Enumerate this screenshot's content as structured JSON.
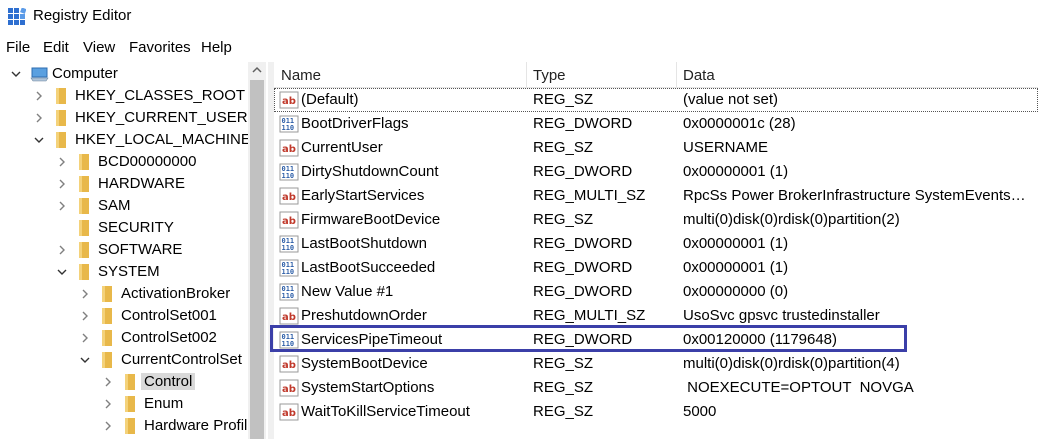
{
  "window": {
    "title": "Registry Editor",
    "icon": "registry-editor-icon"
  },
  "menu": [
    "File",
    "Edit",
    "View",
    "Favorites",
    "Help"
  ],
  "tree": [
    {
      "label": "Computer",
      "level": 0,
      "expanded": true,
      "icon": "computer-icon"
    },
    {
      "label": "HKEY_CLASSES_ROOT",
      "level": 1,
      "expanded": false
    },
    {
      "label": "HKEY_CURRENT_USER",
      "level": 1,
      "expanded": false
    },
    {
      "label": "HKEY_LOCAL_MACHINE",
      "level": 1,
      "expanded": true
    },
    {
      "label": "BCD00000000",
      "level": 2,
      "expanded": false
    },
    {
      "label": "HARDWARE",
      "level": 2,
      "expanded": false
    },
    {
      "label": "SAM",
      "level": 2,
      "expanded": false
    },
    {
      "label": "SECURITY",
      "level": 2,
      "expanded": null
    },
    {
      "label": "SOFTWARE",
      "level": 2,
      "expanded": false
    },
    {
      "label": "SYSTEM",
      "level": 2,
      "expanded": true
    },
    {
      "label": "ActivationBroker",
      "level": 3,
      "expanded": false
    },
    {
      "label": "ControlSet001",
      "level": 3,
      "expanded": false
    },
    {
      "label": "ControlSet002",
      "level": 3,
      "expanded": false
    },
    {
      "label": "CurrentControlSet",
      "level": 3,
      "expanded": true
    },
    {
      "label": "Control",
      "level": 4,
      "expanded": false,
      "selected": true
    },
    {
      "label": "Enum",
      "level": 4,
      "expanded": false
    },
    {
      "label": "Hardware Profil",
      "level": 4,
      "expanded": false
    }
  ],
  "columns": {
    "name": "Name",
    "type": "Type",
    "data": "Data"
  },
  "values": [
    {
      "name": "(Default)",
      "type": "REG_SZ",
      "data": "(value not set)",
      "icon": "string-value-icon"
    },
    {
      "name": "BootDriverFlags",
      "type": "REG_DWORD",
      "data": "0x0000001c (28)",
      "icon": "binary-value-icon"
    },
    {
      "name": "CurrentUser",
      "type": "REG_SZ",
      "data": "USERNAME",
      "icon": "string-value-icon"
    },
    {
      "name": "DirtyShutdownCount",
      "type": "REG_DWORD",
      "data": "0x00000001 (1)",
      "icon": "binary-value-icon"
    },
    {
      "name": "EarlyStartServices",
      "type": "REG_MULTI_SZ",
      "data": "RpcSs Power BrokerInfrastructure SystemEventsBro...",
      "icon": "string-value-icon"
    },
    {
      "name": "FirmwareBootDevice",
      "type": "REG_SZ",
      "data": "multi(0)disk(0)rdisk(0)partition(2)",
      "icon": "string-value-icon"
    },
    {
      "name": "LastBootShutdown",
      "type": "REG_DWORD",
      "data": "0x00000001 (1)",
      "icon": "binary-value-icon"
    },
    {
      "name": "LastBootSucceeded",
      "type": "REG_DWORD",
      "data": "0x00000001 (1)",
      "icon": "binary-value-icon"
    },
    {
      "name": "New Value #1",
      "type": "REG_DWORD",
      "data": "0x00000000 (0)",
      "icon": "binary-value-icon"
    },
    {
      "name": "PreshutdownOrder",
      "type": "REG_MULTI_SZ",
      "data": "UsoSvc gpsvc trustedinstaller",
      "icon": "string-value-icon"
    },
    {
      "name": "ServicesPipeTimeout",
      "type": "REG_DWORD",
      "data": "0x00120000 (1179648)",
      "icon": "binary-value-icon",
      "highlighted": true
    },
    {
      "name": "SystemBootDevice",
      "type": "REG_SZ",
      "data": "multi(0)disk(0)rdisk(0)partition(4)",
      "icon": "string-value-icon"
    },
    {
      "name": "SystemStartOptions",
      "type": "REG_SZ",
      "data": " NOEXECUTE=OPTOUT  NOVGA",
      "icon": "string-value-icon"
    },
    {
      "name": "WaitToKillServiceTimeout",
      "type": "REG_SZ",
      "data": "5000",
      "icon": "string-value-icon"
    }
  ],
  "colors": {
    "highlight_border": "#3b3fa8",
    "string_icon": "#c0392b",
    "binary_icon": "#2e5fa8",
    "folder": "#e8b84a"
  }
}
